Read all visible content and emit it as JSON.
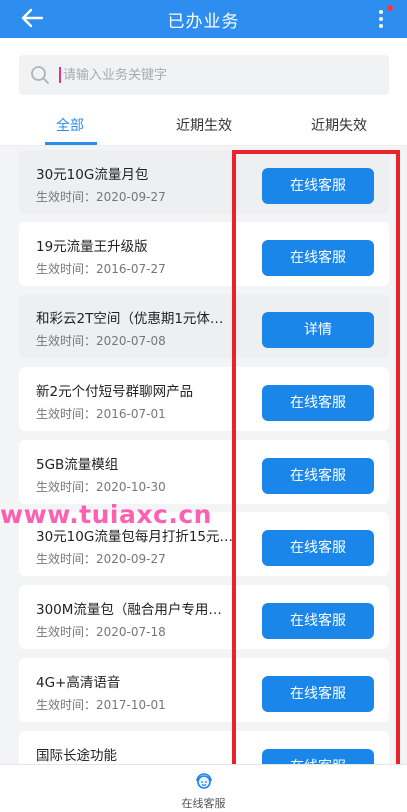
{
  "header": {
    "title": "已办业务",
    "back_icon": "arrow-left-icon",
    "more_icon": "more-vertical-icon"
  },
  "search": {
    "placeholder": "请输入业务关键字"
  },
  "tabs": [
    {
      "label": "全部",
      "active": true
    },
    {
      "label": "近期生效",
      "active": false
    },
    {
      "label": "近期失效",
      "active": false
    }
  ],
  "items": [
    {
      "name": "30元10G流量月包",
      "date": "生效时间：2020-09-27",
      "action": "在线客服"
    },
    {
      "name": "19元流量王升级版",
      "date": "生效时间：2016-07-27",
      "action": "在线客服"
    },
    {
      "name": "和彩云2T空间（优惠期1元体…",
      "date": "生效时间：2020-07-08",
      "action": "详情"
    },
    {
      "name": "新2元个付短号群聊网产品",
      "date": "生效时间：2016-07-01",
      "action": "在线客服"
    },
    {
      "name": "5GB流量模组",
      "date": "生效时间：2020-10-30",
      "action": "在线客服"
    },
    {
      "name": "30元10G流量包每月打折15元…",
      "date": "生效时间：2020-09-27",
      "action": "在线客服"
    },
    {
      "name": "300M流量包（融合用户专用…",
      "date": "生效时间：2020-07-18",
      "action": "在线客服"
    },
    {
      "name": "4G+高清语音",
      "date": "生效时间：2017-10-01",
      "action": "在线客服"
    },
    {
      "name": "国际长途功能",
      "date": "",
      "action": "在线客服"
    }
  ],
  "watermark": "www.tuiaxc.cn",
  "bottom_bar": {
    "label": "在线客服",
    "icon": "customer-service-icon"
  },
  "colors": {
    "primary": "#2d8ef0",
    "button": "#1a86ea",
    "annotation": "#e8232b",
    "watermark": "#ff3aa0"
  }
}
